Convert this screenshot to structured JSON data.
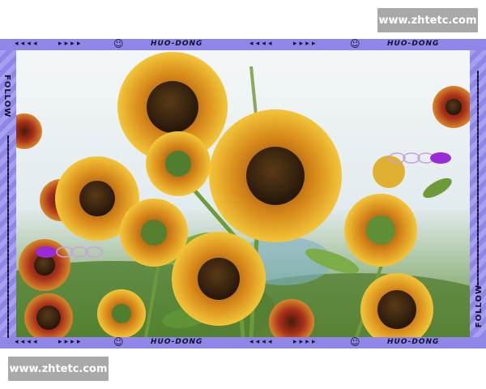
{
  "watermark_top": "www.zhtetc.com",
  "watermark_bottom": "www.zhtetc.com",
  "frame": {
    "brand": "HUO-DONG",
    "follow": "FOLLOW",
    "arrows_right": "▸ ▸ ▸ ▸",
    "arrows_left": "◂ ◂ ◂ ◂",
    "smiley": "☺",
    "accent_color": "#8f86e8"
  },
  "photo": {
    "subject": "sunflowers",
    "petal_color": "#e0a020",
    "center_color": "#3a2410"
  }
}
